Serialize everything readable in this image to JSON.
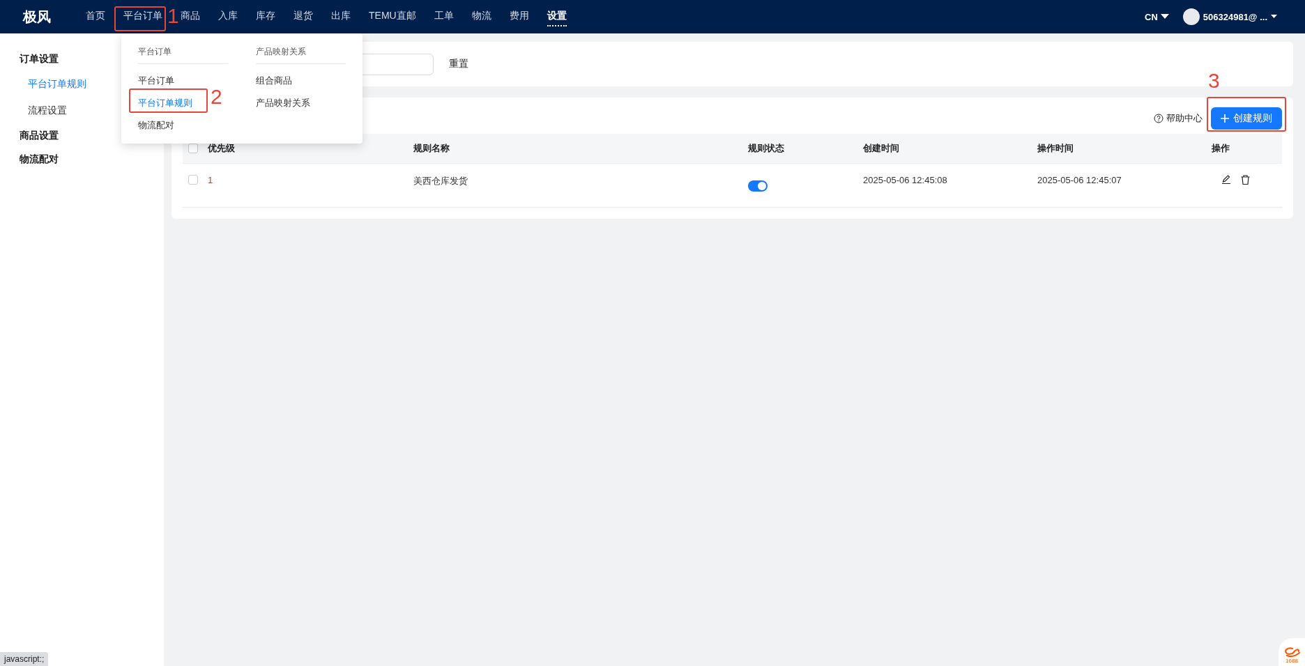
{
  "topbar": {
    "logo": "极风",
    "nav": [
      {
        "label": "首页",
        "selected": false
      },
      {
        "label": "平台订单",
        "selected": false
      },
      {
        "label": "商品",
        "selected": false
      },
      {
        "label": "入库",
        "selected": false
      },
      {
        "label": "库存",
        "selected": false
      },
      {
        "label": "退货",
        "selected": false
      },
      {
        "label": "出库",
        "selected": false
      },
      {
        "label": "TEMU直邮",
        "selected": false
      },
      {
        "label": "工单",
        "selected": false
      },
      {
        "label": "物流",
        "selected": false
      },
      {
        "label": "费用",
        "selected": false
      },
      {
        "label": "设置",
        "selected": true
      }
    ],
    "language": "CN",
    "user": "506324981@ ..."
  },
  "dropdown": {
    "columns": [
      {
        "heading": "平台订单",
        "items": [
          {
            "label": "平台订单",
            "selected": false
          },
          {
            "label": "平台订单规则",
            "selected": true
          },
          {
            "label": "物流配对",
            "selected": false
          }
        ]
      },
      {
        "heading": "产品映射关系",
        "items": [
          {
            "label": "组合商品",
            "selected": false
          },
          {
            "label": "产品映射关系",
            "selected": false
          }
        ]
      }
    ]
  },
  "sidebar": {
    "groups": [
      {
        "label": "订单设置",
        "children": [
          {
            "label": "平台订单规则",
            "selected": true
          },
          {
            "label": "流程设置",
            "selected": false
          }
        ]
      },
      {
        "label": "商品设置"
      },
      {
        "label": "物流配对"
      }
    ]
  },
  "search": {
    "reset": "重置"
  },
  "toolbar": {
    "help": "帮助中心",
    "create": "创建规则"
  },
  "table": {
    "all_checked": false,
    "columns": [
      "优先级",
      "规则名称",
      "规则状态",
      "创建时间",
      "操作时间",
      "操作"
    ],
    "rows": [
      {
        "checked": false,
        "priority": "1",
        "name": "美西仓库发货",
        "on": true,
        "created": "2025-05-06 12:45:08",
        "updated": "2025-05-06 12:45:07"
      }
    ]
  },
  "annotations": [
    "1",
    "2",
    "3"
  ],
  "status_link": "javascript:;",
  "corner_badge": "1688"
}
